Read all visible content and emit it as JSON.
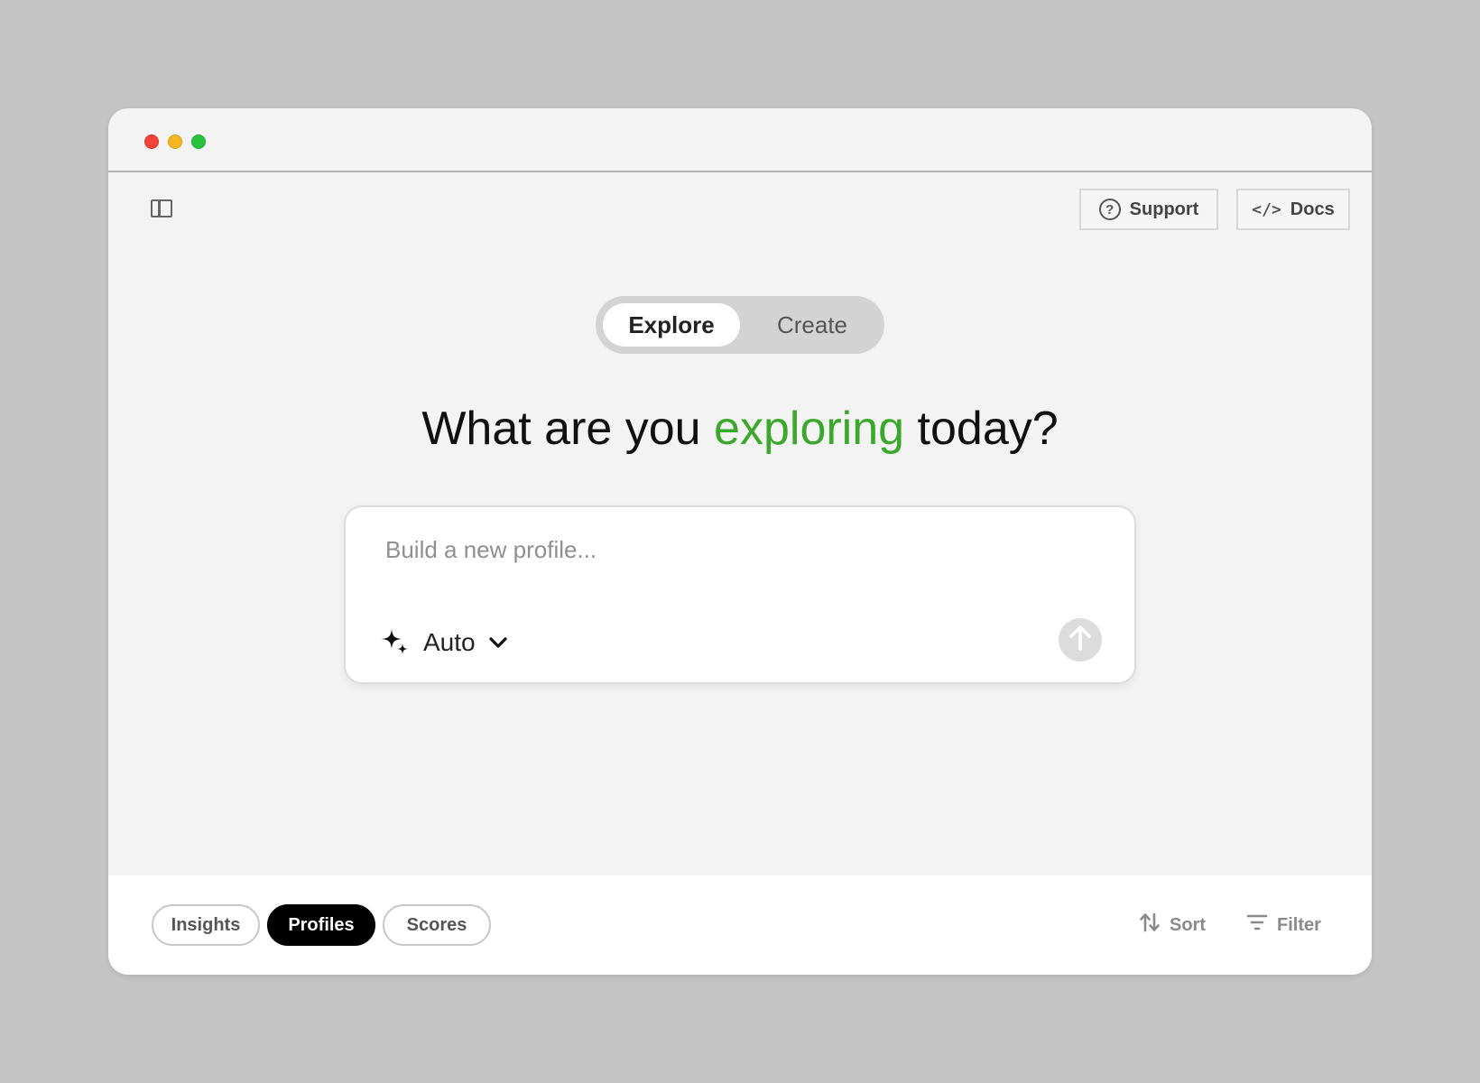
{
  "header": {
    "support_label": "Support",
    "docs_label": "Docs"
  },
  "mode_toggle": {
    "explore_label": "Explore",
    "create_label": "Create",
    "selected": "Explore"
  },
  "headline": {
    "prefix": "What are you ",
    "highlight": "exploring",
    "suffix": " today?",
    "highlight_color": "#3aa82a"
  },
  "prompt": {
    "placeholder": "Build a new profile...",
    "value": "",
    "model_label": "Auto"
  },
  "bottom_bar": {
    "tabs": [
      "Insights",
      "Profiles",
      "Scores"
    ],
    "active_tab": "Profiles",
    "sort_label": "Sort",
    "filter_label": "Filter"
  },
  "icons": {
    "sidebar": "sidebar-toggle-icon",
    "support": "question-circle-icon",
    "docs": "code-icon",
    "model": "sparkle-icon",
    "dropdown": "chevron-down-icon",
    "send": "arrow-up-icon",
    "sort": "sort-arrows-icon",
    "filter": "filter-lines-icon"
  }
}
